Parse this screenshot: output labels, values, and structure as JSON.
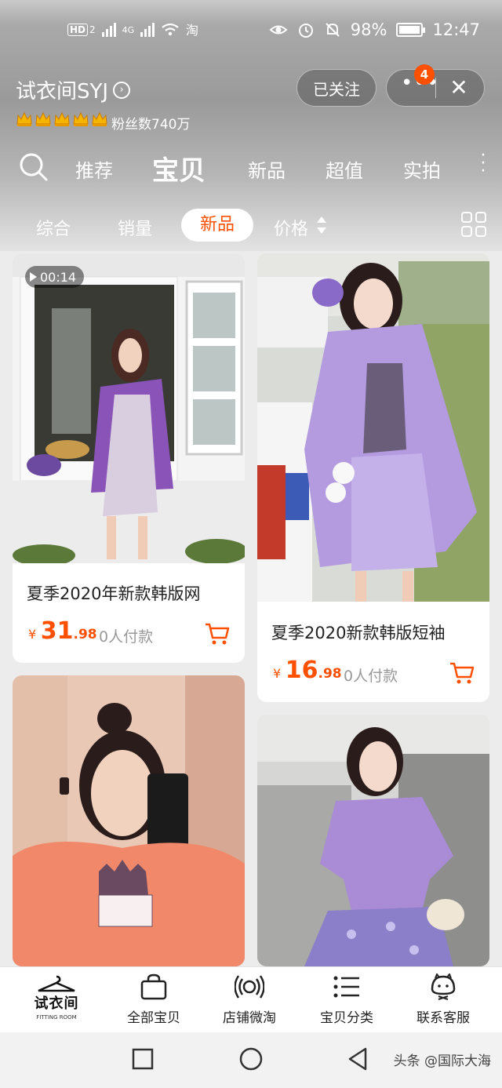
{
  "status_bar": {
    "left_chips": [
      "HD",
      "2"
    ],
    "network_label": "4G",
    "battery": "98%",
    "time": "12:47"
  },
  "shop": {
    "name": "试衣间SYJ",
    "fans_label": "粉丝数740万",
    "follow_label": "已关注",
    "menu_badge": "4",
    "crown_count": 5
  },
  "nav_tabs": [
    {
      "label": "推荐",
      "active": false
    },
    {
      "label": "宝贝",
      "active": true
    },
    {
      "label": "新品",
      "active": false
    },
    {
      "label": "超值",
      "active": false
    },
    {
      "label": "实拍",
      "active": false
    }
  ],
  "filters": [
    {
      "label": "综合",
      "selected": false
    },
    {
      "label": "销量",
      "selected": false
    },
    {
      "label": "新品",
      "selected": true
    },
    {
      "label": "价格",
      "selected": false
    }
  ],
  "products": [
    {
      "title": "夏季2020年新款韩版网",
      "currency": "¥",
      "price_int": "31",
      "price_dec": ".98",
      "sold": "0人付款",
      "video_duration": "00:14"
    },
    {
      "title": "夏季2020新款韩版短袖",
      "currency": "¥",
      "price_int": "16",
      "price_dec": ".98",
      "sold": "0人付款"
    },
    {
      "title": "",
      "currency": "",
      "price_int": "",
      "price_dec": "",
      "sold": ""
    },
    {
      "title": "",
      "currency": "",
      "price_int": "",
      "price_dec": "",
      "sold": ""
    }
  ],
  "shop_nav": {
    "logo_name": "试衣间",
    "logo_sub": "FITTING ROOM",
    "items": [
      {
        "label": "全部宝贝",
        "icon": "shopping-bag-icon"
      },
      {
        "label": "店铺微淘",
        "icon": "broadcast-icon"
      },
      {
        "label": "宝贝分类",
        "icon": "list-icon"
      },
      {
        "label": "联系客服",
        "icon": "customer-service-icon"
      }
    ]
  },
  "watermark": "头条 @国际大海",
  "colors": {
    "accent": "#ff5000",
    "header_gray": "#9a9a9a",
    "lavender": "#a98bd6"
  }
}
